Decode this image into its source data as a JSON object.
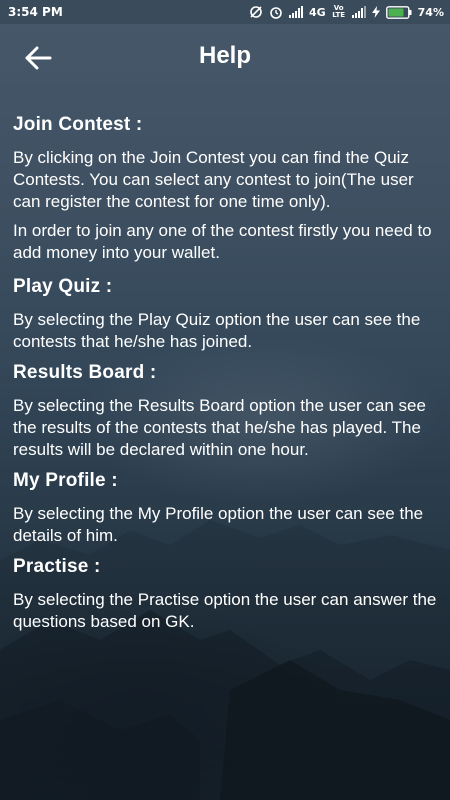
{
  "status_bar": {
    "time": "3:54 PM",
    "network": "4G",
    "volte": "Vo LTE",
    "battery": "74%",
    "icons": [
      "sync-off-icon",
      "alarm-icon",
      "signal-icon",
      "volte-icon",
      "signal-icon",
      "charging-icon",
      "battery-icon"
    ]
  },
  "app_bar": {
    "title": "Help",
    "back_icon": "arrow-left-icon"
  },
  "sections": [
    {
      "heading": "Join Contest :",
      "paragraphs": [
        "By clicking on the Join Contest you can find the Quiz Contests. You can select any contest to join(The user can register the contest for one time only).",
        "In order to join any one of the contest firstly you need to add money into your wallet."
      ]
    },
    {
      "heading": "Play Quiz :",
      "paragraphs": [
        "By selecting the Play Quiz option the user can see the contests that he/she has joined."
      ]
    },
    {
      "heading": "Results Board :",
      "paragraphs": [
        "By selecting the Results Board option the user can see the results of the contests that he/she has played. The results will be declared within one hour."
      ]
    },
    {
      "heading": "My Profile :",
      "paragraphs": [
        "By selecting the My Profile option the user can see the details of him."
      ]
    },
    {
      "heading": "Practise :",
      "paragraphs": [
        "By selecting the Practise option the user can answer the questions based on GK."
      ]
    }
  ],
  "colors": {
    "text": "#ffffff",
    "background_top": "#46586a",
    "background_bottom": "#142029",
    "battery_fill": "#4caf50"
  }
}
